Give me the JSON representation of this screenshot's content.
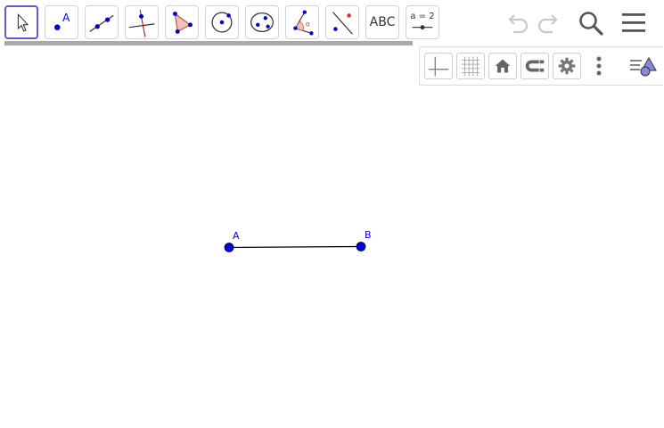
{
  "toolbar": {
    "tools": [
      {
        "id": "move",
        "icon": "move-arrow-icon",
        "selected": true
      },
      {
        "id": "point",
        "icon": "point-icon",
        "label": "A"
      },
      {
        "id": "line",
        "icon": "line-icon"
      },
      {
        "id": "perpendicular",
        "icon": "perpendicular-line-icon"
      },
      {
        "id": "polygon",
        "icon": "polygon-icon"
      },
      {
        "id": "circle",
        "icon": "circle-center-point-icon"
      },
      {
        "id": "ellipse",
        "icon": "ellipse-icon"
      },
      {
        "id": "angle",
        "icon": "angle-icon",
        "label": "α"
      },
      {
        "id": "reflect",
        "icon": "reflect-about-line-icon"
      },
      {
        "id": "text",
        "icon": "text-icon",
        "label": "ABC"
      },
      {
        "id": "slider",
        "icon": "slider-icon",
        "label": "a = 2"
      }
    ],
    "right": [
      "undo-icon",
      "redo-icon",
      "search-icon",
      "menu-icon"
    ]
  },
  "stylebar": {
    "buttons": [
      "axes-icon",
      "grid-icon",
      "home-icon",
      "point-capture-icon",
      "settings-icon",
      "more-vertical-icon",
      "style-bar-toggle-icon"
    ]
  },
  "canvas": {
    "points": [
      {
        "name": "A",
        "label": "A"
      },
      {
        "name": "B",
        "label": "B"
      }
    ],
    "segment": {
      "from": "A",
      "to": "B"
    },
    "colors": {
      "point": "#0000cc",
      "label": "#0000ff",
      "segment": "#000000",
      "accent": "#6557d2"
    }
  }
}
